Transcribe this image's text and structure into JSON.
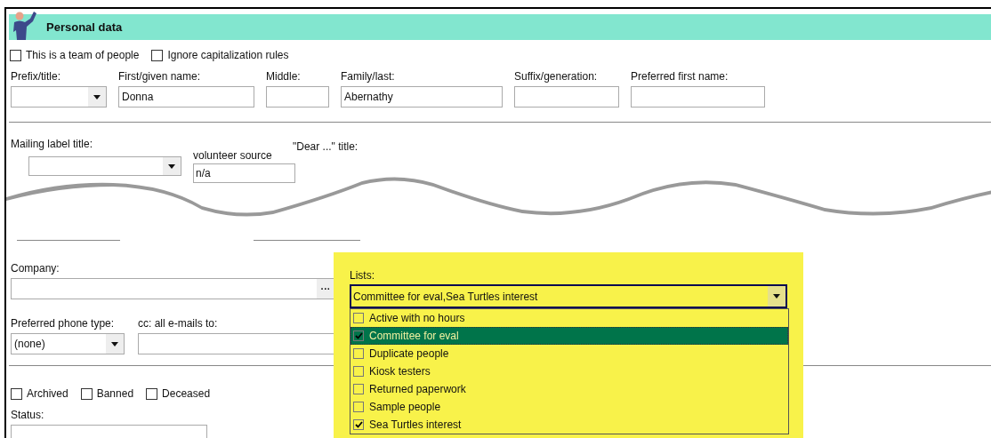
{
  "header": {
    "title": "Personal data"
  },
  "top_checkboxes": [
    {
      "label": "This is a team of people",
      "checked": false
    },
    {
      "label": "Ignore capitalization rules",
      "checked": false
    }
  ],
  "name_fields": [
    {
      "kind": "combo",
      "label": "Prefix/title:"
    },
    {
      "kind": "text",
      "label": "First/given name:",
      "value": "Donna"
    },
    {
      "kind": "text",
      "label": "Middle:"
    },
    {
      "kind": "text",
      "label": "Family/last:",
      "value": "Abernathy"
    },
    {
      "kind": "text",
      "label": "Suffix/generation:"
    },
    {
      "kind": "text",
      "label": "Preferred first name:"
    }
  ],
  "torn_row": {
    "mailing_label": "Mailing label title:",
    "volunteer_source_label": "volunteer source",
    "volunteer_source_value": "n/a",
    "dear_title": "\"Dear ...\" title:"
  },
  "company": {
    "label": "Company:",
    "button": "···"
  },
  "lists": {
    "label": "Lists:",
    "value": "Committee for eval,Sea Turtles interest",
    "items": [
      {
        "label": "Active with no hours",
        "checked": false,
        "selected": false
      },
      {
        "label": "Committee for eval",
        "checked": true,
        "selected": true
      },
      {
        "label": "Duplicate people",
        "checked": false,
        "selected": false
      },
      {
        "label": "Kiosk testers",
        "checked": false,
        "selected": false
      },
      {
        "label": "Returned paperwork",
        "checked": false,
        "selected": false
      },
      {
        "label": "Sample people",
        "checked": false,
        "selected": false
      },
      {
        "label": "Sea Turtles interest",
        "checked": true,
        "selected": false
      }
    ]
  },
  "phone": {
    "label": "Preferred phone type:",
    "value": "(none)"
  },
  "cc": {
    "label": "cc: all e-mails to:"
  },
  "flags": [
    {
      "label": "Archived",
      "checked": false
    },
    {
      "label": "Banned",
      "checked": false
    },
    {
      "label": "Deceased",
      "checked": false
    }
  ],
  "status": {
    "label": "Status:"
  }
}
